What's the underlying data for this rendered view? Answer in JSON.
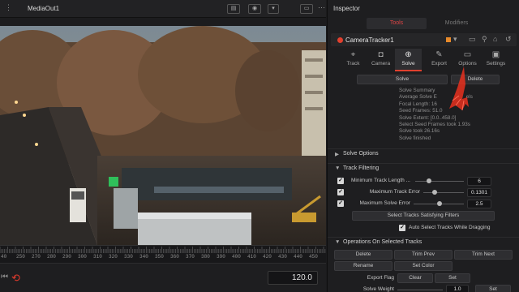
{
  "viewer": {
    "title": "MediaOut1",
    "frame_value": "120.0",
    "ruler_ticks": [
      "40",
      "250",
      "270",
      "280",
      "290",
      "300",
      "310",
      "320",
      "330",
      "340",
      "350",
      "360",
      "370",
      "380",
      "390",
      "400",
      "410",
      "420",
      "430",
      "440",
      "450"
    ]
  },
  "inspector": {
    "title": "Inspector",
    "tabs": {
      "tools": "Tools",
      "modifiers": "Modifiers"
    },
    "node_name": "CameraTracker1",
    "tool_tabs": [
      {
        "label": "Track",
        "icon": "track-icon"
      },
      {
        "label": "Camera",
        "icon": "camera-icon"
      },
      {
        "label": "Solve",
        "icon": "solve-icon",
        "active": true
      },
      {
        "label": "Export",
        "icon": "export-icon"
      },
      {
        "label": "Options",
        "icon": "options-icon"
      },
      {
        "label": "Settings",
        "icon": "settings-icon"
      }
    ],
    "solve_button": "Solve",
    "delete_button": "Delete",
    "summary": {
      "l1": "Solve Summary",
      "l2": "Average Solve E",
      "l2b": "els",
      "l3": "Focal Length: 16",
      "l4": "Seed Frames: 51.0",
      "l5": "Solve Extent: [0.0..458.0]",
      "l6": "Select Seed Frames took 1.93s",
      "l7": "Solve took 26.16s",
      "l8": "Solve finished"
    },
    "solve_options_header": "Solve Options",
    "track_filtering_header": "Track Filtering",
    "filters": [
      {
        "label": "Minimum Track Length ...",
        "value": "6",
        "checked": true
      },
      {
        "label": "Maximum Track Error",
        "value": "0.1301",
        "checked": true
      },
      {
        "label": "Maximum Solve Error",
        "value": "2.5",
        "checked": true
      }
    ],
    "select_tracks_button": "Select Tracks Satisfying Filters",
    "auto_select_label": "Auto Select Tracks While Dragging",
    "operations_header": "Operations On Selected Tracks",
    "ops": {
      "delete": "Delete",
      "trim_prev": "Trim Prev",
      "trim_next": "Trim Next",
      "rename": "Rename",
      "set_color": "Set Color",
      "export_flag": "Export Flag",
      "clear": "Clear",
      "set": "Set",
      "solve_weight_label": "Solve Weight",
      "solve_weight_value": "1.0",
      "set2": "Set"
    }
  },
  "colors": {
    "accent_red": "#e0402e",
    "node_orange": "#e88a2a",
    "annotation_red": "#e8301e"
  }
}
